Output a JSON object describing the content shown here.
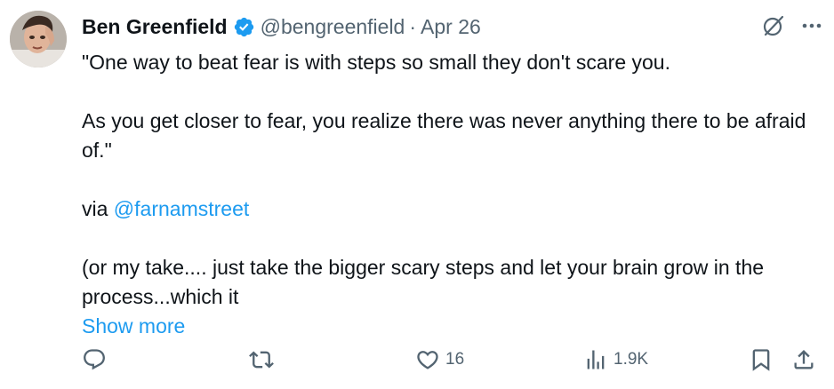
{
  "author": {
    "display_name": "Ben Greenfield",
    "handle": "@bengreenfield",
    "separator": "·",
    "date": "Apr 26",
    "verified": true
  },
  "tweet": {
    "line1": "\"One way to beat fear is with steps so small they don't scare you.",
    "line2": "As you get closer to fear, you realize there was never anything there to be afraid of.\"",
    "via_text": "via ",
    "via_link": "@farnamstreet",
    "line4": "(or my take.... just take the bigger scary steps and let your brain grow in the process...which it",
    "show_more": "Show more"
  },
  "actions": {
    "reply_count": "",
    "retweet_count": "",
    "like_count": "16",
    "views_count": "1.9K"
  },
  "icons": {
    "verified": "verified-badge-icon",
    "grok": "grok-icon",
    "more": "more-icon",
    "reply": "reply-icon",
    "retweet": "retweet-icon",
    "like": "heart-icon",
    "views": "views-icon",
    "bookmark": "bookmark-icon",
    "share": "share-icon"
  },
  "colors": {
    "text": "#0f1419",
    "secondary": "#536471",
    "link": "#1d9bf0"
  }
}
